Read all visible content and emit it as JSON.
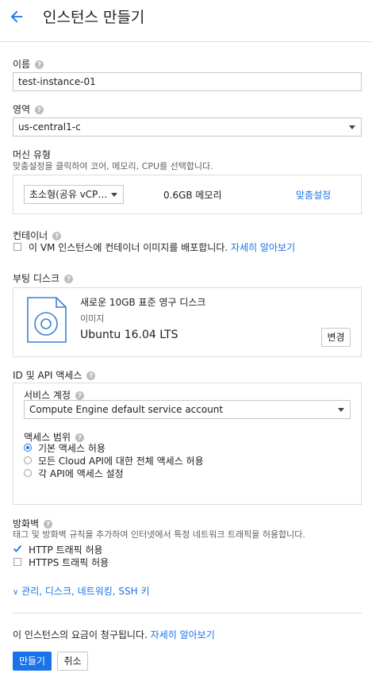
{
  "header": {
    "title": "인스턴스 만들기"
  },
  "name": {
    "label": "이름",
    "value": "test-instance-01"
  },
  "zone": {
    "label": "영역",
    "value": "us-central1-c"
  },
  "machine": {
    "label": "머신 유형",
    "description": "맞춤설정을 클릭하여 코어, 메모리, CPU를 선택합니다.",
    "type_value": "초소형(공유 vCP…",
    "memory": "0.6GB 메모리",
    "customize_label": "맞춤설정"
  },
  "container": {
    "label": "컨테이너",
    "checkbox_text": "이 VM 인스턴스에 컨테이너 이미지를 배포합니다.",
    "learn_more": "자세히 알아보기"
  },
  "boot_disk": {
    "label": "부팅 디스크",
    "title": "새로운 10GB 표준 영구 디스크",
    "image_label": "이미지",
    "image_value": "Ubuntu 16.04 LTS",
    "change_label": "변경"
  },
  "identity": {
    "label": "ID 및 API 액세스",
    "service_account_label": "서비스 계정",
    "service_account_value": "Compute Engine default service account",
    "scope_label": "액세스 범위",
    "scopes": [
      "기본 액세스 허용",
      "모든 Cloud API에 대한 전체 액세스 허용",
      "각 API에 액세스 설정"
    ],
    "selected_scope": 0
  },
  "firewall": {
    "label": "방화벽",
    "description": "태그 및 방화벽 규칙을 추가하여 인터넷에서 특정 네트워크 트래픽을 허용합니다.",
    "http_label": "HTTP 트래픽 허용",
    "http_checked": true,
    "https_label": "HTTPS 트래픽 허용",
    "https_checked": false
  },
  "advanced_link": "관리, 디스크, 네트워킹, SSH 키",
  "billing": {
    "text": "이 인스턴스의 요금이 청구됩니다.",
    "learn_more": "자세히 알아보기"
  },
  "actions": {
    "create_label": "만들기",
    "cancel_label": "취소"
  },
  "colors": {
    "accent": "#1a73e8",
    "border": "#dadce0"
  }
}
